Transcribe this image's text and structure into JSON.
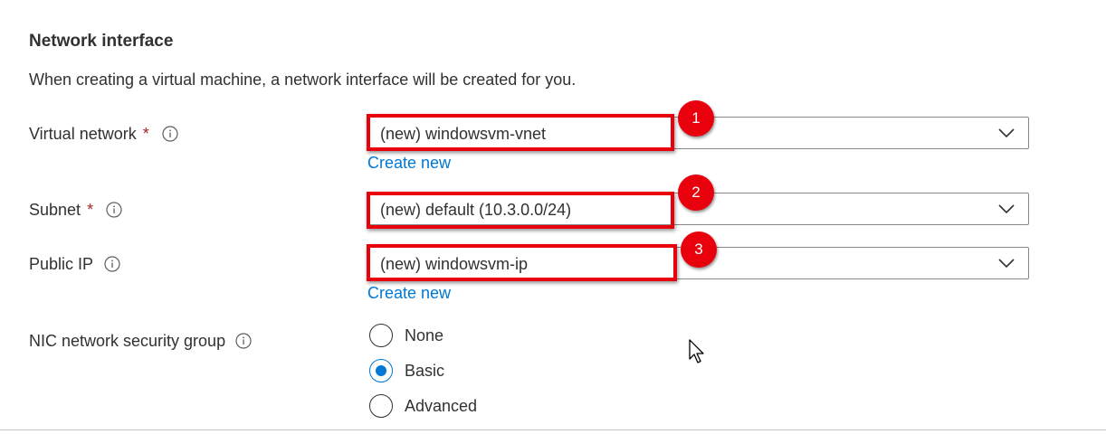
{
  "section": {
    "title": "Network interface",
    "description": "When creating a virtual machine, a network interface will be created for you."
  },
  "fields": {
    "virtual_network": {
      "label": "Virtual network",
      "required_mark": "*",
      "value": "(new) windowsvm-vnet",
      "link": "Create new",
      "badge": "1"
    },
    "subnet": {
      "label": "Subnet",
      "required_mark": "*",
      "value": "(new) default (10.3.0.0/24)",
      "badge": "2"
    },
    "public_ip": {
      "label": "Public IP",
      "value": "(new) windowsvm-ip",
      "link": "Create new",
      "badge": "3"
    },
    "nic_nsg": {
      "label": "NIC network security group",
      "options": [
        "None",
        "Basic",
        "Advanced"
      ],
      "selected": "Basic"
    }
  },
  "colors": {
    "accent": "#0078d4",
    "required": "#a4262c",
    "highlight": "#e8000d",
    "text": "#323130"
  }
}
